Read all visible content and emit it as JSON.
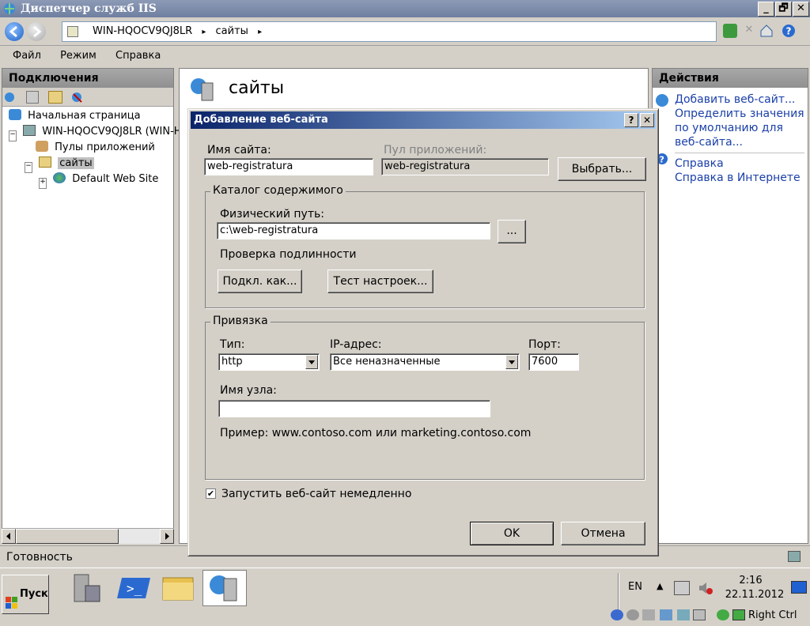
{
  "window": {
    "title": "Диспетчер служб IIS",
    "min": "_",
    "max": "🗗",
    "close": "✕"
  },
  "address": {
    "server": "WIN-HQOCV9QJ8LR",
    "node": "сайты",
    "sep": "▸"
  },
  "menu": [
    "Файл",
    "Режим",
    "Справка"
  ],
  "left": {
    "header": "Подключения",
    "tree": [
      {
        "label": "Начальная страница",
        "indent": 0
      },
      {
        "label": "WIN-HQOCV9QJ8LR (WIN-H",
        "indent": 0
      },
      {
        "label": "Пулы приложений",
        "indent": 1
      },
      {
        "label": "сайты",
        "indent": 1
      },
      {
        "label": "Default Web Site",
        "indent": 2
      }
    ]
  },
  "center": {
    "title": "сайты"
  },
  "right": {
    "header": "Действия",
    "actions": [
      "Добавить веб-сайт...",
      "Определить значения по умолчанию для веб-сайта...",
      "Справка",
      "Справка в Интернете"
    ]
  },
  "status": {
    "text": "Готовность"
  },
  "dialog": {
    "title": "Добавление веб-сайта",
    "help": "?",
    "close": "✕",
    "site_name_label": "Имя сайта:",
    "site_name_value": "web-registratura",
    "pool_label": "Пул приложений:",
    "pool_value": "web-registratura",
    "select_button": "Выбрать...",
    "content_group": "Каталог содержимого",
    "phys_path_label": "Физический путь:",
    "phys_path_value": "c:\\web-registratura",
    "browse_button": "...",
    "auth_label": "Проверка подлинности",
    "connect_as_button": "Подкл. как...",
    "test_button": "Тест настроек...",
    "binding_group": "Привязка",
    "type_label": "Тип:",
    "type_value": "http",
    "ip_label": "IP-адрес:",
    "ip_value": "Все неназначенные",
    "port_label": "Порт:",
    "port_value": "7600",
    "host_label": "Имя узла:",
    "host_value": "",
    "example_text": "Пример: www.contoso.com или marketing.contoso.com",
    "start_checkbox_label": "Запустить веб-сайт немедленно",
    "start_checked": "✔",
    "ok_button": "OK",
    "cancel_button": "Отмена"
  },
  "taskbar": {
    "start": "Пуск",
    "lang": "EN",
    "time": "2:16",
    "date": "22.11.2012",
    "host_key": "Right Ctrl"
  },
  "colors": {
    "titlebar": "#7a88a8",
    "dialog_title": "#0a246a",
    "link": "#1a3fa8"
  }
}
